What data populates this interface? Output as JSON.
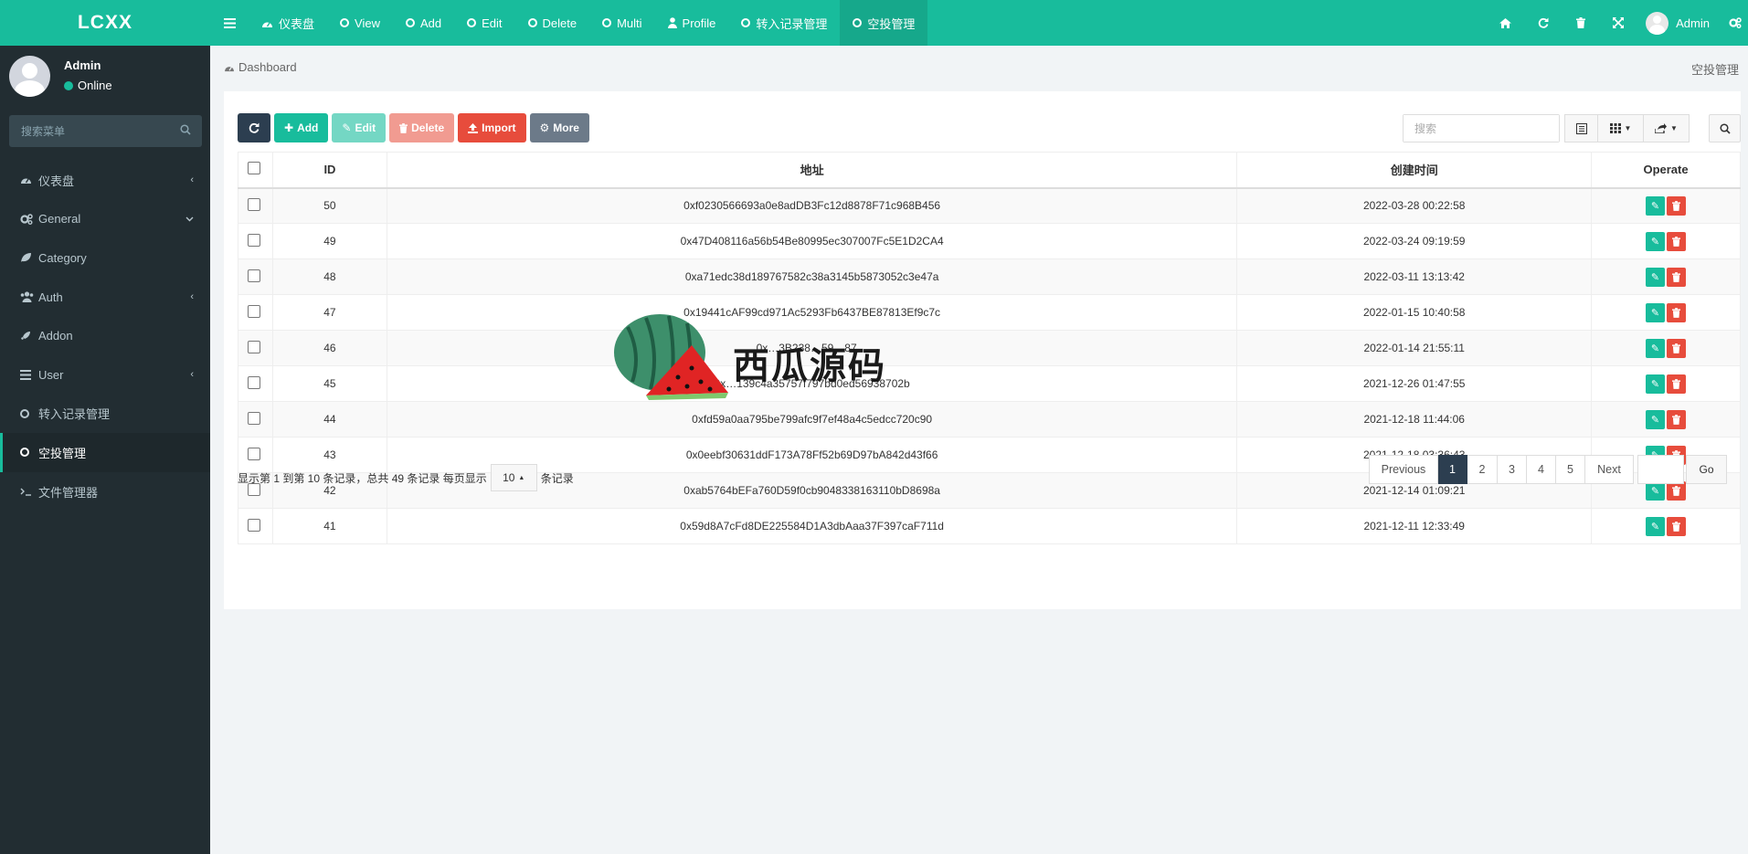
{
  "logo": "LCXX",
  "user": {
    "name": "Admin",
    "status": "Online"
  },
  "sidebar": {
    "search_placeholder": "搜索菜单",
    "items": [
      {
        "label": "仪表盘",
        "icon": "dashboard-icon",
        "caret": "left"
      },
      {
        "label": "General",
        "icon": "cogs-icon",
        "caret": "down"
      },
      {
        "label": "Category",
        "icon": "leaf-icon",
        "caret": ""
      },
      {
        "label": "Auth",
        "icon": "users-icon",
        "caret": "left"
      },
      {
        "label": "Addon",
        "icon": "rocket-icon",
        "caret": ""
      },
      {
        "label": "User",
        "icon": "list-icon",
        "caret": "left"
      },
      {
        "label": "转入记录管理",
        "icon": "circle-icon",
        "caret": ""
      },
      {
        "label": "空投管理",
        "icon": "circle-icon",
        "caret": "",
        "active": true
      },
      {
        "label": "文件管理器",
        "icon": "terminal-icon",
        "caret": ""
      }
    ]
  },
  "topbar": {
    "tabs": [
      {
        "label": "仪表盘",
        "icon": "dashboard-icon"
      },
      {
        "label": "View",
        "icon": "circle-icon"
      },
      {
        "label": "Add",
        "icon": "circle-icon"
      },
      {
        "label": "Edit",
        "icon": "circle-icon"
      },
      {
        "label": "Delete",
        "icon": "circle-icon"
      },
      {
        "label": "Multi",
        "icon": "circle-icon"
      },
      {
        "label": "Profile",
        "icon": "user-icon"
      },
      {
        "label": "转入记录管理",
        "icon": "circle-icon"
      },
      {
        "label": "空投管理",
        "icon": "circle-icon",
        "active": true
      }
    ],
    "user_name": "Admin"
  },
  "breadcrumb": {
    "label": "Dashboard",
    "right": "空投管理"
  },
  "toolbar": {
    "add": "Add",
    "edit": "Edit",
    "delete": "Delete",
    "import": "Import",
    "more": "More"
  },
  "search_placeholder": "搜索",
  "table": {
    "headers": [
      "ID",
      "地址",
      "创建时间",
      "Operate"
    ],
    "rows": [
      {
        "id": "50",
        "address": "0xf0230566693a0e8adDB3Fc12d8878F71c968B456",
        "created": "2022-03-28 00:22:58"
      },
      {
        "id": "49",
        "address": "0x47D408116a56b54Be80995ec307007Fc5E1D2CA4",
        "created": "2022-03-24 09:19:59"
      },
      {
        "id": "48",
        "address": "0xa71edc38d189767582c38a3145b5873052c3e47a",
        "created": "2022-03-11 13:13:42"
      },
      {
        "id": "47",
        "address": "0x19441cAF99cd971Ac5293Fb6437BE87813Ef9c7c",
        "created": "2022-01-15 10:40:58"
      },
      {
        "id": "46",
        "address": "0x…3B238…59…87…",
        "created": "2022-01-14 21:55:11"
      },
      {
        "id": "45",
        "address": "0x…139c4a35757f797bd0ed56938702b",
        "created": "2021-12-26 01:47:55"
      },
      {
        "id": "44",
        "address": "0xfd59a0aa795be799afc9f7ef48a4c5edcc720c90",
        "created": "2021-12-18 11:44:06"
      },
      {
        "id": "43",
        "address": "0x0eebf30631ddF173A78Ff52b69D97bA842d43f66",
        "created": "2021-12-18 03:36:43"
      },
      {
        "id": "42",
        "address": "0xab5764bEFa760D59f0cb9048338163110bD8698a",
        "created": "2021-12-14 01:09:21"
      },
      {
        "id": "41",
        "address": "0x59d8A7cFd8DE225584D1A3dbAaa37F397caF711d",
        "created": "2021-12-11 12:33:49"
      }
    ]
  },
  "footer": {
    "info_prefix": "显示第 1 到第 10 条记录，总共 49 条记录 每页显示",
    "page_size": "10",
    "info_suffix": "条记录"
  },
  "pagination": {
    "previous": "Previous",
    "pages": [
      "1",
      "2",
      "3",
      "4",
      "5"
    ],
    "current": "1",
    "next": "Next",
    "go": "Go"
  },
  "watermark": "西瓜源码",
  "colors": {
    "brand": "#18bc9c",
    "sidebar": "#222d32",
    "danger": "#e74c3c",
    "dark": "#2c3e50"
  }
}
